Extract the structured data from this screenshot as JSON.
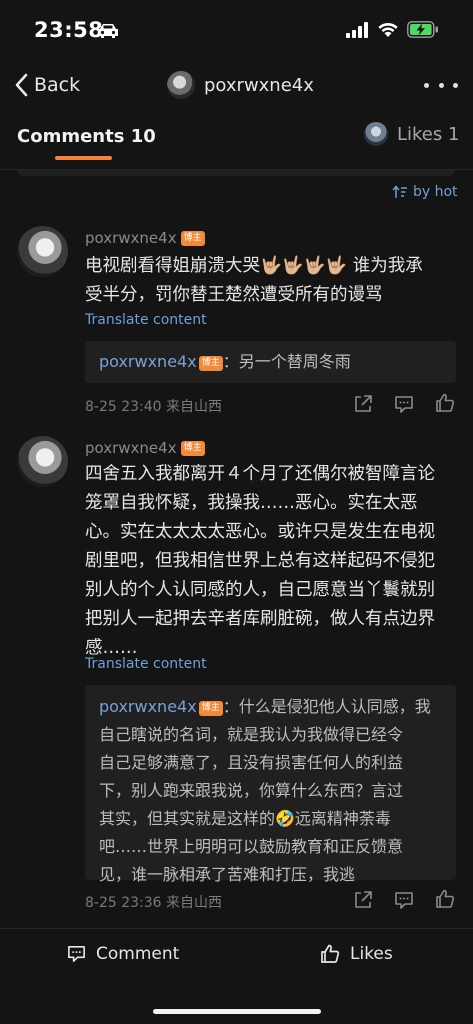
{
  "status_bar": {
    "time": "23:58"
  },
  "nav": {
    "back_label": "Back",
    "title": "poxrwxne4x"
  },
  "tabs": {
    "comments_label": "Comments 10",
    "likes_label": "Likes 1"
  },
  "sort": {
    "label": "by hot"
  },
  "op_badge": "博主",
  "translate_label": "Translate content",
  "comments": [
    {
      "user": "poxrwxne4x",
      "lines": [
        "电视剧看得姐崩溃大哭🤟🏼🤟🏼🤟🏼🤟🏼 谁为我承",
        "受半分，罚你替王楚然遭受所有的谩骂"
      ],
      "reply_user": "poxrwxne4x",
      "reply_lines": [
        "：另一个替周冬雨"
      ],
      "meta": "8-25 23:40 来自山西"
    },
    {
      "user": "poxrwxne4x",
      "lines": [
        "四舍五入我都离开４个月了还偶尔被智障言论",
        "笼罩自我怀疑，我操我……恶心。实在太恶",
        "心。实在太太太太恶心。或许只是发生在电视",
        "剧里吧，但我相信世界上总有这样起码不侵犯",
        "别人的个人认同感的人，自己愿意当丫鬟就别",
        "把别人一起押去辛者库刷脏碗，做人有点边界",
        "感……"
      ],
      "reply_user": "poxrwxne4x",
      "reply_lines": [
        "：什么是侵犯他人认同感，我",
        "自己瞎说的名词，就是我认为我做得已经令",
        "自己足够满意了，且没有损害任何人的利益",
        "下，别人跑来跟我说，你算什么东西？言过",
        "其实，但其实就是这样的🤣远离精神荼毒",
        "吧……世界上明明可以鼓励教育和正反馈意",
        "见，谁一脉相承了苦难和打压，我逃"
      ],
      "meta": "8-25 23:36 来自山西"
    }
  ],
  "bottom": {
    "comment_label": "Comment",
    "likes_label": "Likes"
  },
  "colors": {
    "accent": "#f7813a",
    "link": "#6f9fd6",
    "badge": "#f38a3a",
    "background": "#141414"
  },
  "icons": [
    "car-icon",
    "signal-icon",
    "wifi-icon",
    "battery-charging-icon",
    "chevron-left-icon",
    "more-icon",
    "sort-icon",
    "share-icon",
    "reply-icon",
    "like-icon",
    "comment-icon"
  ]
}
